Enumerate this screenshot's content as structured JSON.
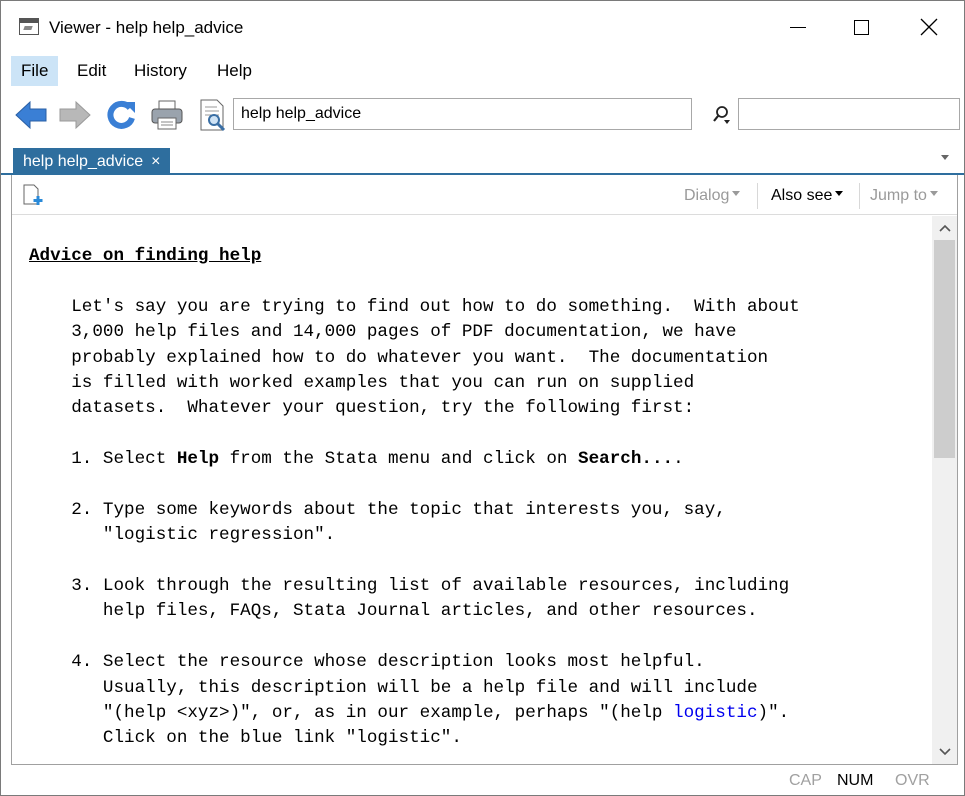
{
  "window": {
    "title": "Viewer - help help_advice"
  },
  "menu": {
    "items": [
      {
        "label": "File"
      },
      {
        "label": "Edit"
      },
      {
        "label": "History"
      },
      {
        "label": "Help"
      }
    ]
  },
  "toolbar": {
    "address_value": "help help_advice",
    "find_value": ""
  },
  "tabs": [
    {
      "label": "help help_advice",
      "close_glyph": "×"
    }
  ],
  "pane_toolbar": {
    "dialog_label": "Dialog",
    "also_see_label": "Also see",
    "jump_to_label": "Jump to"
  },
  "help": {
    "heading": "Advice on finding help",
    "intro": [
      "Let's say you are trying to find out how to do something.  With about",
      "3,000 help files and 14,000 pages of PDF documentation, we have",
      "probably explained how to do whatever you want.  The documentation",
      "is filled with worked examples that you can run on supplied",
      "datasets.  Whatever your question, try the following first:"
    ],
    "step1": {
      "a": "1. Select ",
      "b": "Help",
      "c": " from the Stata menu and click on ",
      "d": "Search...",
      "e": "."
    },
    "step2": [
      "2. Type some keywords about the topic that interests you, say,",
      "   \"logistic regression\"."
    ],
    "step3": [
      "3. Look through the resulting list of available resources, including",
      "   help files, FAQs, Stata Journal articles, and other resources."
    ],
    "step4": {
      "line1": "4. Select the resource whose description looks most helpful.",
      "line2": "   Usually, this description will be a help file and will include",
      "line3a": "   \"(help <xyz>)\", or, as in our example, perhaps \"(help ",
      "line3link": "logistic",
      "line3b": ")\".",
      "line4": "   Click on the blue link \"logistic\"."
    }
  },
  "status": {
    "cap": "CAP",
    "num": "NUM",
    "ovr": "OVR"
  },
  "colors": {
    "tab_bg": "#2e6e9e",
    "menu_active": "#cce4f7",
    "link": "#0000ee",
    "nav_blue": "#3a7fd5",
    "nav_gray": "#b8b8b8"
  }
}
